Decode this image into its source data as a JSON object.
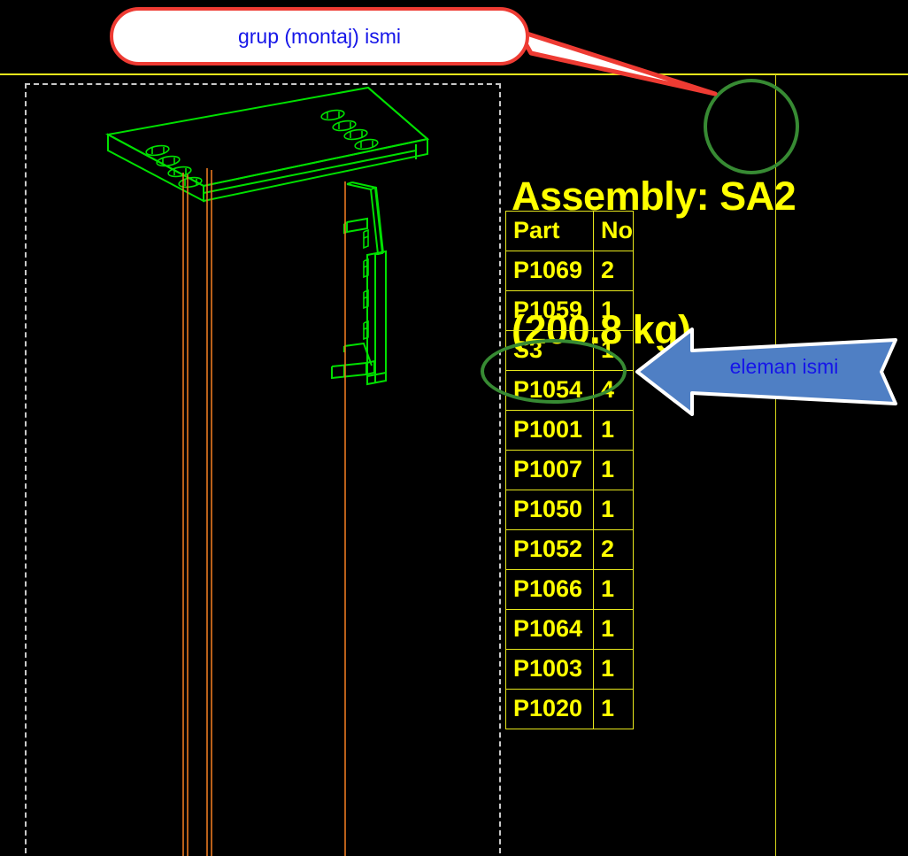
{
  "sheet": {
    "background_color": "#000000",
    "frame_line_color": "#e8e81c",
    "viewport_border_color": "#c9c9c9"
  },
  "assembly": {
    "title_line1": "Assembly: SA2",
    "title_line2": "(200.8 kg)",
    "name": "SA2",
    "weight": "200.8 kg",
    "title_color": "#ffff00"
  },
  "callout": {
    "label": "grup (montaj) ismi",
    "text_color": "#1616e8",
    "border_color": "#ee3b33",
    "fill_color": "#ffffff"
  },
  "arrow_annotation": {
    "label": "eleman ismi",
    "text_color": "#1616e8",
    "fill_color": "#4f7fc4",
    "border_color": "#ffffff",
    "direction": "left"
  },
  "highlights": {
    "circle_target": "SA2",
    "ellipse_target": "S3",
    "color": "#378a33"
  },
  "parts_table": {
    "headers": [
      "Part",
      "No"
    ],
    "rows": [
      {
        "part": "P1069",
        "no": "2"
      },
      {
        "part": "P1059",
        "no": "1"
      },
      {
        "part": "S3",
        "no": "1"
      },
      {
        "part": "P1054",
        "no": "4"
      },
      {
        "part": "P1001",
        "no": "1"
      },
      {
        "part": "P1007",
        "no": "1"
      },
      {
        "part": "P1050",
        "no": "1"
      },
      {
        "part": "P1052",
        "no": "2"
      },
      {
        "part": "P1066",
        "no": "1"
      },
      {
        "part": "P1064",
        "no": "1"
      },
      {
        "part": "P1003",
        "no": "1"
      },
      {
        "part": "P1020",
        "no": "1"
      }
    ],
    "border_color": "#e8e81c",
    "text_color": "#ffff00"
  },
  "model": {
    "wireframe_color": "#00e000",
    "column_color": "#e87820",
    "description": "3D wireframe of bracket assembly: base plate with bolt holes, angle stiffener and column"
  }
}
